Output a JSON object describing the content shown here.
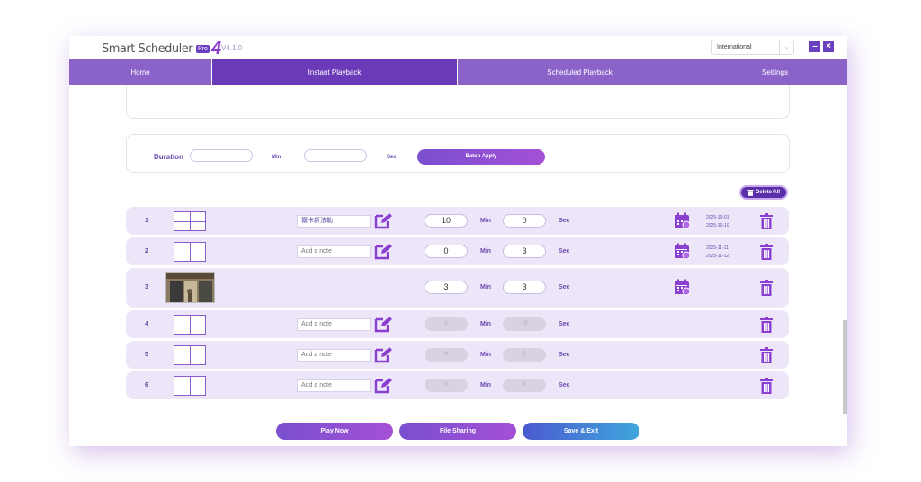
{
  "app": {
    "logo_text": "Smart Scheduler",
    "logo_badge": "Pro",
    "logo_number": "4",
    "version": "V4.1.0"
  },
  "window_controls": {
    "language_selected": "International",
    "minimize_label": "–",
    "close_label": "×"
  },
  "nav": {
    "tabs": [
      {
        "label": "Home",
        "active": false
      },
      {
        "label": "Instant Playback",
        "active": true
      },
      {
        "label": "Scheduled Playback",
        "active": false
      },
      {
        "label": "Settings",
        "active": false
      }
    ]
  },
  "batch": {
    "duration_label": "Duration",
    "min_unit": "Min",
    "sec_unit": "Sec",
    "apply_label": "Batch Apply"
  },
  "delete_all_label": "Delete All",
  "rows": [
    {
      "num": "1",
      "layout": "quad",
      "note": "爾卡新法勒",
      "note_filled": true,
      "min": "10",
      "sec": "0",
      "disabled": false,
      "min_unit": "Min",
      "sec_unit": "Sec",
      "has_calendar": true,
      "dates": [
        "2025-10-01",
        "2025-10-10"
      ]
    },
    {
      "num": "2",
      "layout": "split",
      "note": "Add a note",
      "note_filled": false,
      "min": "0",
      "sec": "3",
      "disabled": false,
      "min_unit": "Min",
      "sec_unit": "Sec",
      "has_calendar": true,
      "dates": [
        "2025-11-11",
        "2025-11-12"
      ]
    },
    {
      "num": "3",
      "layout": "image",
      "note": "",
      "note_filled": false,
      "min": "3",
      "sec": "3",
      "disabled": false,
      "min_unit": "Min",
      "sec_unit": "Sec",
      "has_calendar": true,
      "dates": []
    },
    {
      "num": "4",
      "layout": "split",
      "note": "Add a note",
      "note_filled": false,
      "min": "0",
      "sec": "10",
      "disabled": true,
      "min_unit": "Min",
      "sec_unit": "Sec",
      "has_calendar": false,
      "dates": []
    },
    {
      "num": "5",
      "layout": "split",
      "note": "Add a note",
      "note_filled": false,
      "min": "0",
      "sec": "3",
      "disabled": true,
      "min_unit": "Min",
      "sec_unit": "Sec",
      "has_calendar": false,
      "dates": []
    },
    {
      "num": "6",
      "layout": "split",
      "note": "Add a note",
      "note_filled": false,
      "min": "0",
      "sec": "3",
      "disabled": true,
      "min_unit": "Min",
      "sec_unit": "Sec",
      "has_calendar": false,
      "dates": []
    }
  ],
  "footer": {
    "play_now": "Play Now",
    "file_sharing": "File Sharing",
    "save_exit": "Save & Exit"
  },
  "colors": {
    "accent": "#6a3ab8",
    "nav": "#8a62c8",
    "row_bg": "#ede6f8",
    "save_exit": "#3fa6dc"
  }
}
